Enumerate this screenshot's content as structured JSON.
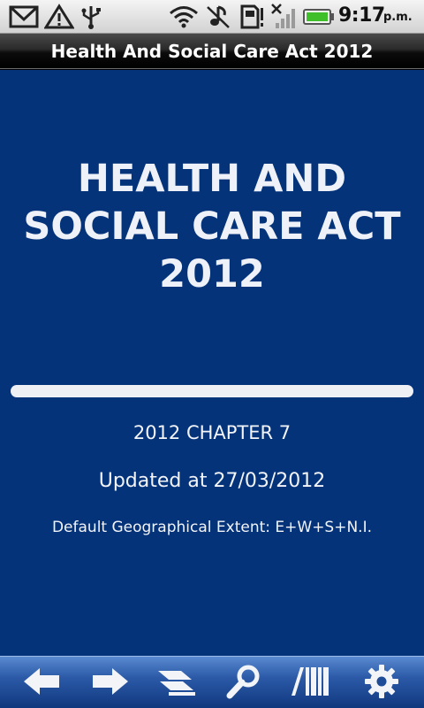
{
  "status_bar": {
    "time": "9:17",
    "ampm": "p.m.",
    "icons": [
      "gmail-icon",
      "warning-icon",
      "usb-icon",
      "wifi-icon",
      "music-off-icon",
      "sd-card-icon",
      "signal-off-icon",
      "battery-icon"
    ]
  },
  "app": {
    "title": "Health And Social Care Act 2012"
  },
  "content": {
    "heading": "HEALTH AND SOCIAL CARE ACT 2012",
    "chapter": "2012 CHAPTER 7",
    "updated": "Updated at 27/03/2012",
    "extent": "Default Geographical Extent: E+W+S+N.I."
  },
  "toolbar": {
    "icons": [
      "back-arrow-icon",
      "forward-arrow-icon",
      "contents-icon",
      "search-icon",
      "library-icon",
      "settings-gear-icon"
    ]
  },
  "colors": {
    "content_bg": "#04337a",
    "toolbar": "#2c5aa8",
    "battery_green": "#3fbf2a"
  }
}
